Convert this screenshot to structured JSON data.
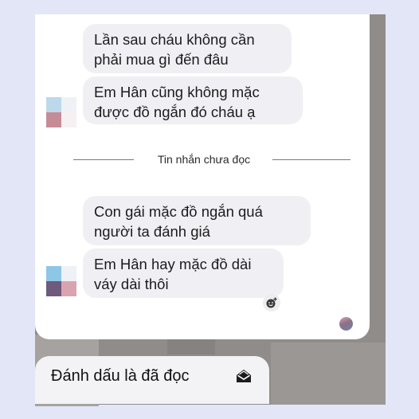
{
  "messages_before": [
    {
      "text": "Lần sau cháu không cần phải mua gì đến đâu"
    },
    {
      "text": "Em Hân cũng không mặc được đồ ngắn đó cháu ạ"
    }
  ],
  "unread_divider": {
    "label": "Tin nhắn chưa đọc"
  },
  "messages_after": [
    {
      "text": "Con gái mặc đồ ngắn quá người ta đánh giá"
    },
    {
      "text": "Em Hân hay mặc đồ dài váy dài thôi"
    }
  ],
  "action_sheet": {
    "mark_read_label": "Đánh dấu là đã đọc",
    "mark_read_icon": "envelope-open-icon"
  },
  "icons": {
    "react": "add-reaction-icon"
  },
  "colors": {
    "background": "#e3e6f7",
    "bubble": "#f0f0f4",
    "sheet": "#f3f3f5"
  }
}
